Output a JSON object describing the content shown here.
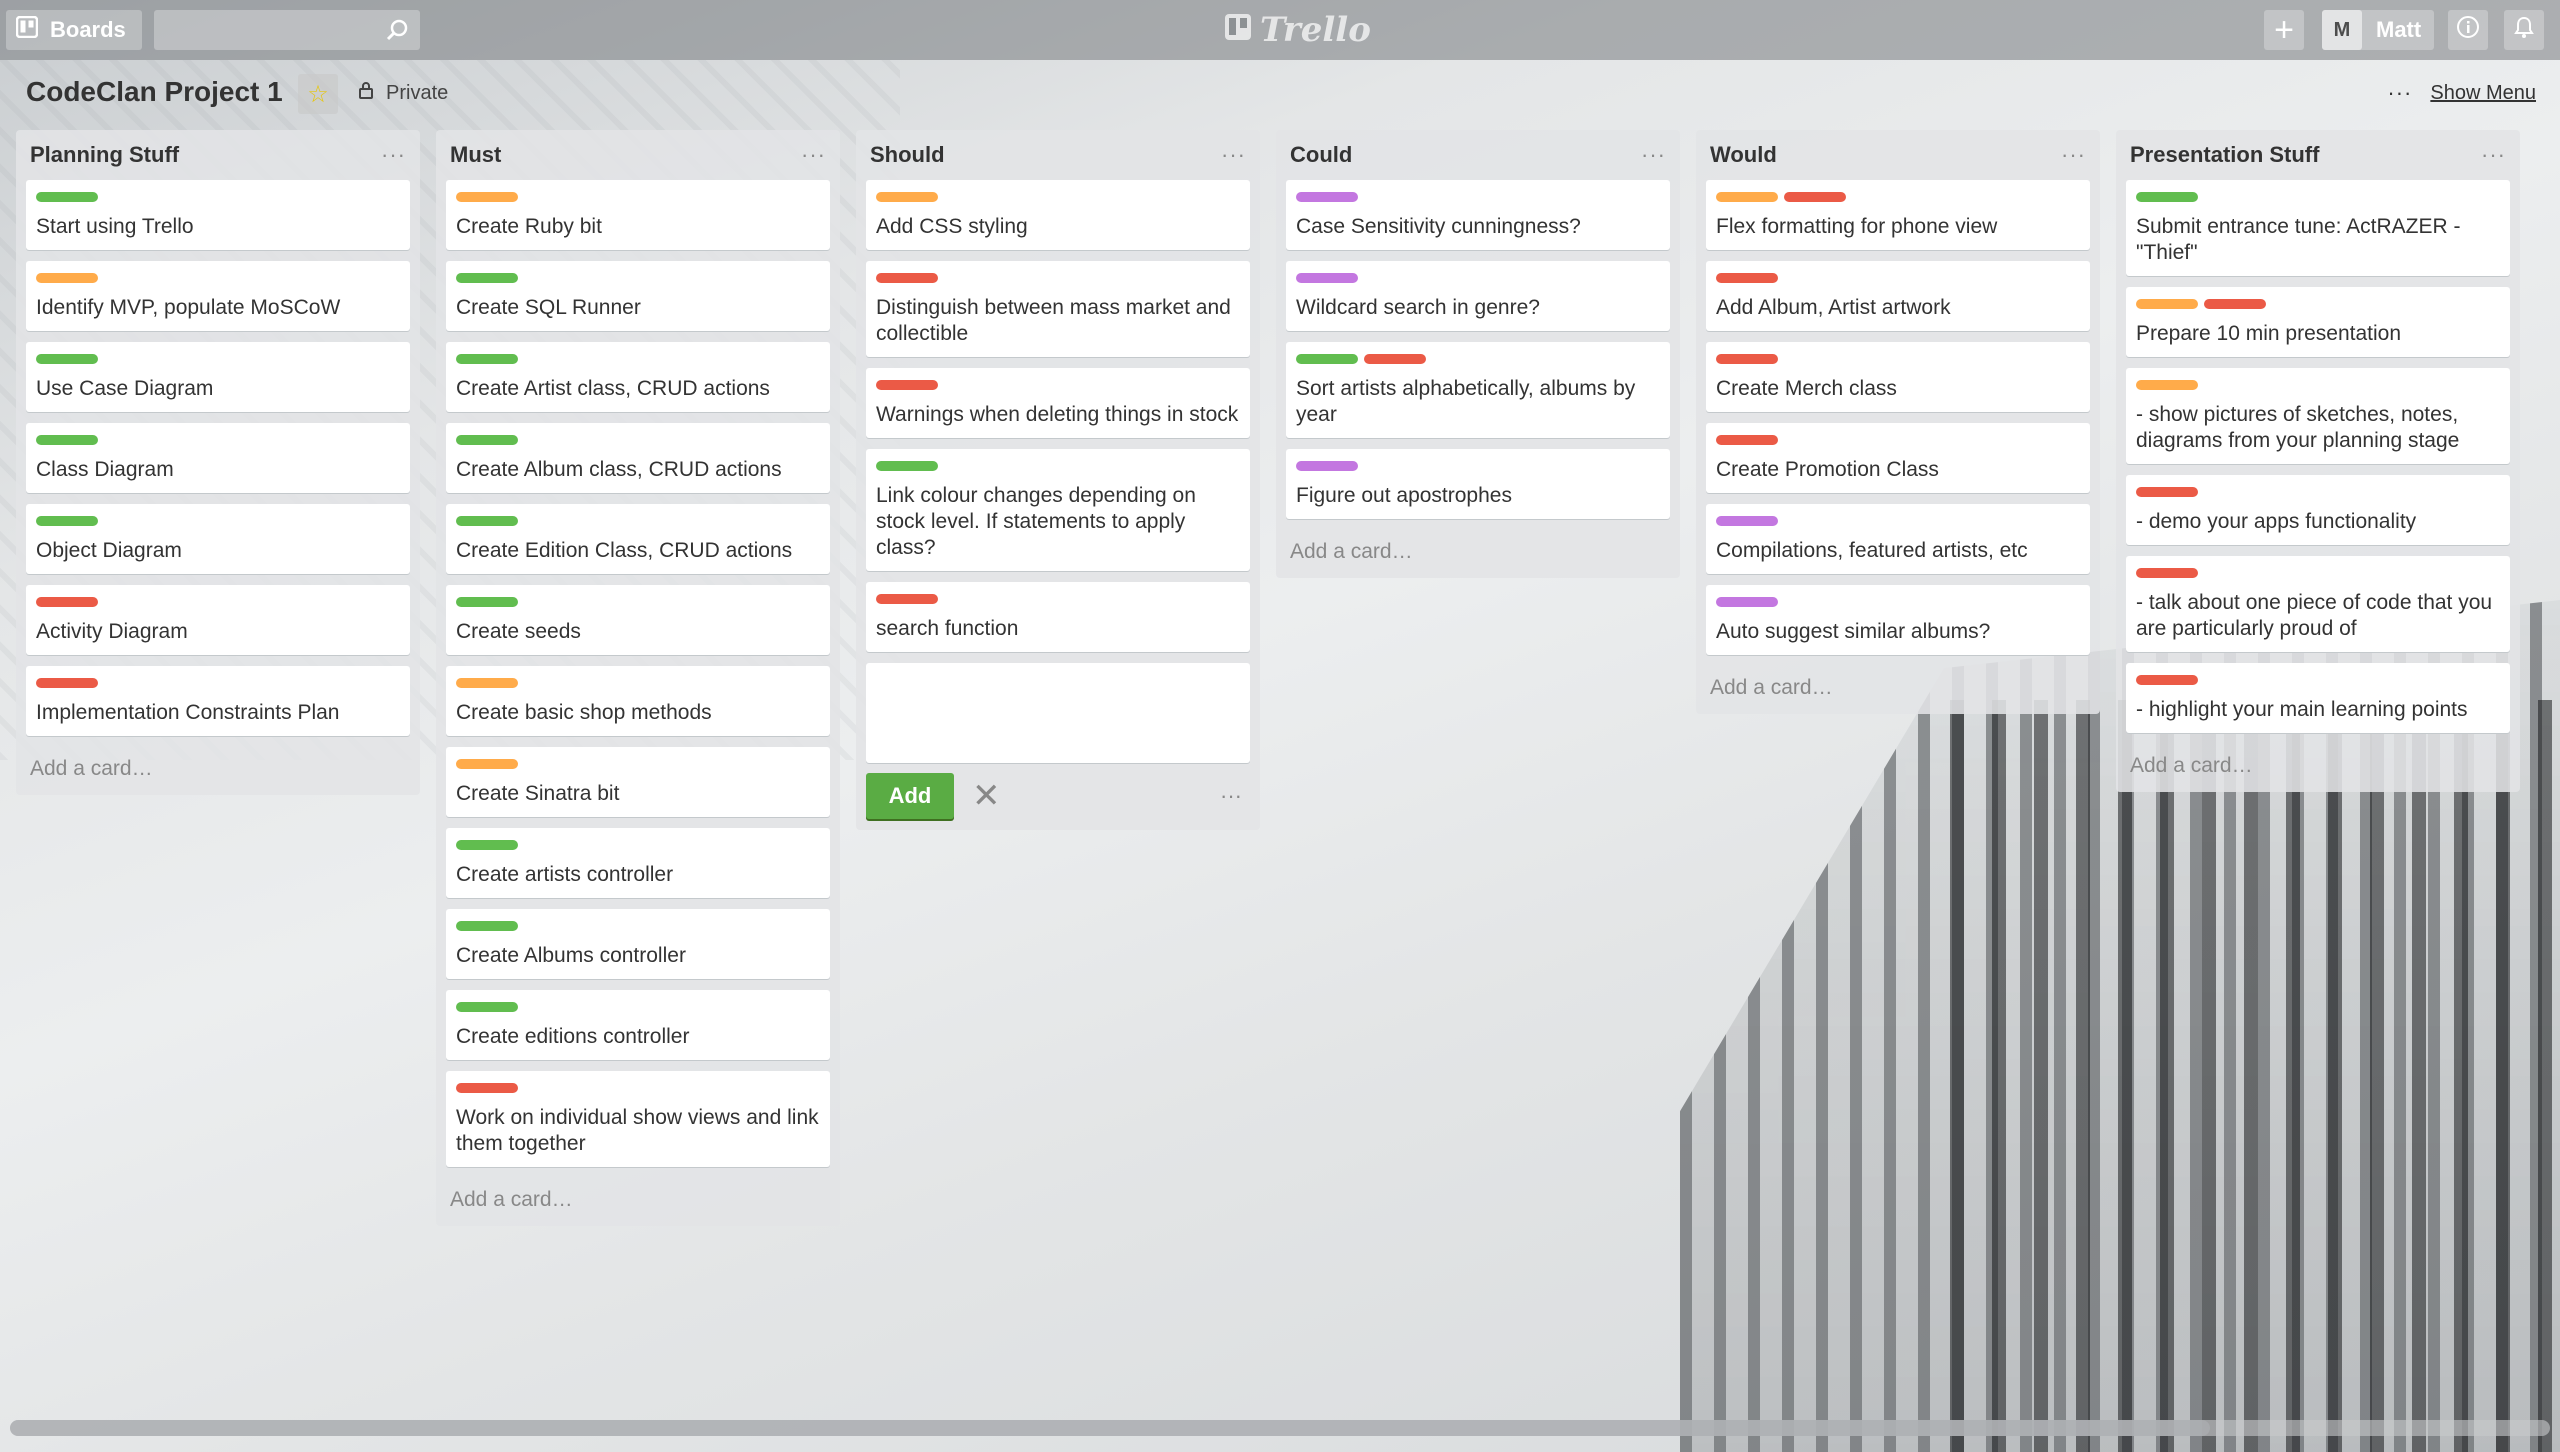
{
  "header": {
    "boards_label": "Boards",
    "search_placeholder": "",
    "logo_text": "Trello",
    "user_initial": "M",
    "user_name": "Matt"
  },
  "board": {
    "title": "CodeClan Project 1",
    "visibility": "Private",
    "show_menu_label": "Show Menu"
  },
  "colors": {
    "green": "#61bd4f",
    "orange": "#ffab4a",
    "red": "#eb5a46",
    "purple": "#c377e0"
  },
  "lists": [
    {
      "title": "Planning Stuff",
      "add_label": "Add a card…",
      "cards": [
        {
          "labels": [
            "green"
          ],
          "text": "Start using Trello"
        },
        {
          "labels": [
            "orange"
          ],
          "text": "Identify MVP, populate MoSCoW"
        },
        {
          "labels": [
            "green"
          ],
          "text": "Use Case Diagram"
        },
        {
          "labels": [
            "green"
          ],
          "text": "Class Diagram"
        },
        {
          "labels": [
            "green"
          ],
          "text": "Object Diagram"
        },
        {
          "labels": [
            "red"
          ],
          "text": "Activity Diagram"
        },
        {
          "labels": [
            "red"
          ],
          "text": "Implementation Constraints Plan"
        }
      ]
    },
    {
      "title": "Must",
      "add_label": "Add a card…",
      "cards": [
        {
          "labels": [
            "orange"
          ],
          "text": "Create Ruby bit"
        },
        {
          "labels": [
            "green"
          ],
          "text": "Create SQL Runner"
        },
        {
          "labels": [
            "green"
          ],
          "text": "Create Artist class, CRUD actions"
        },
        {
          "labels": [
            "green"
          ],
          "text": "Create Album class, CRUD actions"
        },
        {
          "labels": [
            "green"
          ],
          "text": "Create Edition Class, CRUD actions"
        },
        {
          "labels": [
            "green"
          ],
          "text": "Create seeds"
        },
        {
          "labels": [
            "orange"
          ],
          "text": "Create basic shop methods"
        },
        {
          "labels": [
            "orange"
          ],
          "text": "Create Sinatra bit"
        },
        {
          "labels": [
            "green"
          ],
          "text": "Create artists controller"
        },
        {
          "labels": [
            "green"
          ],
          "text": "Create Albums controller"
        },
        {
          "labels": [
            "green"
          ],
          "text": "Create editions controller"
        },
        {
          "labels": [
            "red"
          ],
          "text": "Work on individual show views and link them together"
        }
      ]
    },
    {
      "title": "Should",
      "add_label": "Add",
      "cards": [
        {
          "labels": [
            "orange"
          ],
          "text": "Add CSS styling"
        },
        {
          "labels": [
            "red"
          ],
          "text": "Distinguish between mass market and collectible"
        },
        {
          "labels": [
            "red"
          ],
          "text": "Warnings when deleting things in stock"
        },
        {
          "labels": [
            "green"
          ],
          "text": "Link colour changes depending on stock level. If statements to apply class?"
        },
        {
          "labels": [
            "red"
          ],
          "text": "search function"
        }
      ]
    },
    {
      "title": "Could",
      "add_label": "Add a card…",
      "cards": [
        {
          "labels": [
            "purple"
          ],
          "text": "Case Sensitivity cunningness?"
        },
        {
          "labels": [
            "purple"
          ],
          "text": "Wildcard search in genre?"
        },
        {
          "labels": [
            "green",
            "red"
          ],
          "text": "Sort artists alphabetically, albums by year"
        },
        {
          "labels": [
            "purple"
          ],
          "text": "Figure out apostrophes"
        }
      ]
    },
    {
      "title": "Would",
      "add_label": "Add a card…",
      "cards": [
        {
          "labels": [
            "orange",
            "red"
          ],
          "text": "Flex formatting for phone view"
        },
        {
          "labels": [
            "red"
          ],
          "text": "Add Album, Artist artwork"
        },
        {
          "labels": [
            "red"
          ],
          "text": "Create Merch class"
        },
        {
          "labels": [
            "red"
          ],
          "text": "Create Promotion Class"
        },
        {
          "labels": [
            "purple"
          ],
          "text": "Compilations, featured artists, etc"
        },
        {
          "labels": [
            "purple"
          ],
          "text": "Auto suggest similar albums?"
        }
      ]
    },
    {
      "title": "Presentation Stuff",
      "add_label": "Add a card…",
      "cards": [
        {
          "labels": [
            "green"
          ],
          "text": "Submit entrance tune: ActRAZER - \"Thief\""
        },
        {
          "labels": [
            "orange",
            "red"
          ],
          "text": "Prepare 10 min presentation"
        },
        {
          "labels": [
            "orange"
          ],
          "text": "- show pictures of sketches, notes, diagrams from your planning stage"
        },
        {
          "labels": [
            "red"
          ],
          "text": "- demo your apps functionality"
        },
        {
          "labels": [
            "red"
          ],
          "text": "- talk about one piece of code that you are particularly proud of"
        },
        {
          "labels": [
            "red"
          ],
          "text": "- highlight your main learning points"
        }
      ]
    }
  ]
}
